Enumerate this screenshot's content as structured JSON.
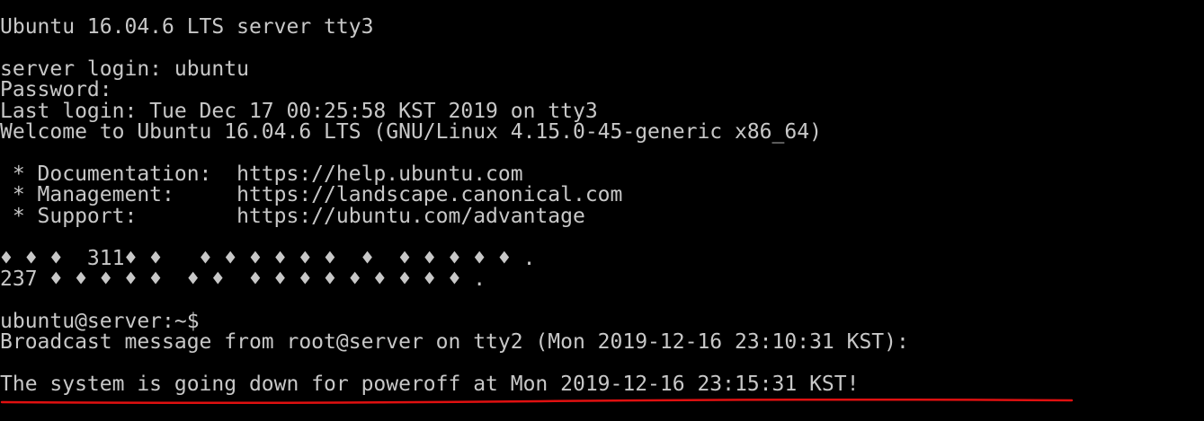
{
  "terminal": {
    "background": "#000000",
    "text_color": "#c8c8c8",
    "lines": {
      "banner": "Ubuntu 16.04.6 LTS server tty3",
      "login": "server login: ubuntu",
      "password": "Password:",
      "last_login": "Last login: Tue Dec 17 00:25:58 KST 2019 on tty3",
      "welcome": "Welcome to Ubuntu 16.04.6 LTS (GNU/Linux 4.15.0-45-generic x86_64)",
      "documentation": " * Documentation:  https://help.ubuntu.com",
      "management": " * Management:     https://landscape.canonical.com",
      "support": " * Support:        https://ubuntu.com/advantage",
      "garbled_1": "♦ ♦ ♦  311♦ ♦   ♦ ♦ ♦ ♦ ♦ ♦  ♦  ♦ ♦ ♦ ♦ ♦ .",
      "garbled_2": "237 ♦ ♦ ♦ ♦ ♦  ♦ ♦  ♦ ♦ ♦ ♦ ♦ ♦ ♦ ♦ ♦ .",
      "prompt": "ubuntu@server:~$",
      "broadcast": "Broadcast message from root@server on tty2 (Mon 2019-12-16 23:10:31 KST):",
      "shutdown": "The system is going down for poweroff at Mon 2019-12-16 23:15:31 KST!"
    }
  },
  "annotation": {
    "underline_color": "#e01010"
  }
}
